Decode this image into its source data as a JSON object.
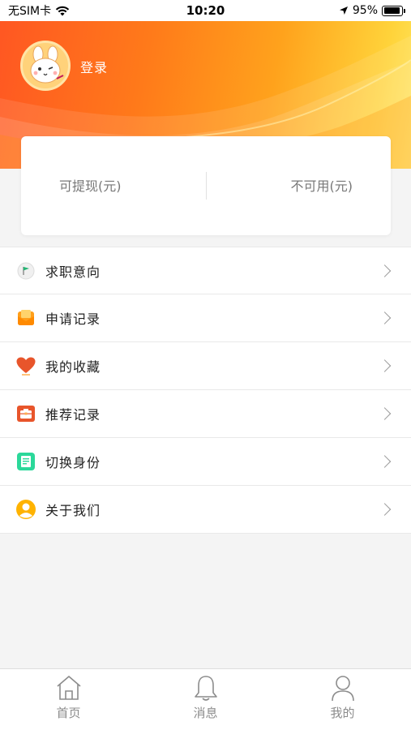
{
  "status_bar": {
    "carrier": "无SIM卡",
    "time": "10:20",
    "battery": "95%",
    "battery_level": 0.95
  },
  "profile": {
    "login_label": "登录"
  },
  "balance": {
    "withdrawable_label": "可提现(元)",
    "unavailable_label": "不可用(元)"
  },
  "menu": {
    "items": [
      {
        "label": "求职意向",
        "icon": "flag-icon",
        "color": "#22b573"
      },
      {
        "label": "申请记录",
        "icon": "envelope-icon",
        "color": "#ff9f1a"
      },
      {
        "label": "我的收藏",
        "icon": "heart-icon",
        "color": "#e8552b"
      },
      {
        "label": "推荐记录",
        "icon": "briefcase-icon",
        "color": "#e8552b"
      },
      {
        "label": "切换身份",
        "icon": "id-card-icon",
        "color": "#2bd89a"
      },
      {
        "label": "关于我们",
        "icon": "user-circle-icon",
        "color": "#ffb300"
      }
    ]
  },
  "tabbar": {
    "tabs": [
      {
        "label": "首页",
        "icon": "home-icon"
      },
      {
        "label": "消息",
        "icon": "bell-icon"
      },
      {
        "label": "我的",
        "icon": "person-icon"
      }
    ]
  }
}
